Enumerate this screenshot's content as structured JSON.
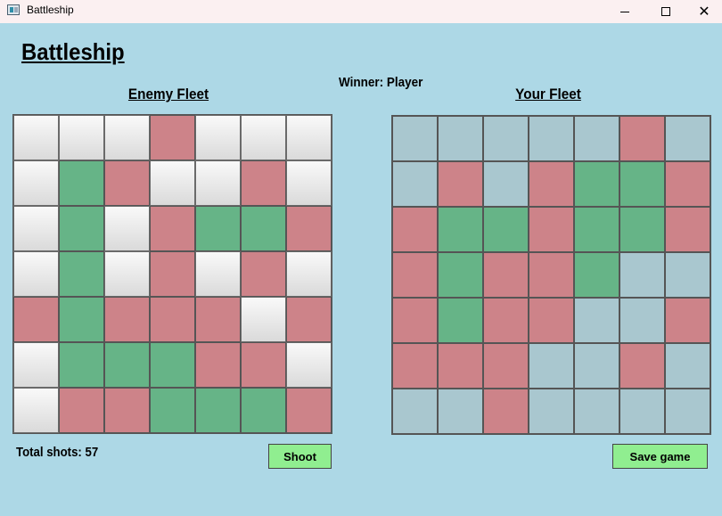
{
  "window": {
    "title": "Battleship",
    "minimize_icon": "minimize-icon",
    "maximize_icon": "maximize-icon",
    "close_glyph": "✕"
  },
  "heading": "Battleship",
  "winner_text": "Winner: Player",
  "enemy": {
    "label": "Enemy Fleet",
    "grid": [
      [
        "unknown",
        "unknown",
        "unknown",
        "miss",
        "unknown",
        "unknown",
        "unknown"
      ],
      [
        "unknown",
        "hit",
        "miss",
        "unknown",
        "unknown",
        "miss",
        "unknown"
      ],
      [
        "unknown",
        "hit",
        "unknown",
        "miss",
        "hit",
        "hit",
        "miss"
      ],
      [
        "unknown",
        "hit",
        "unknown",
        "miss",
        "unknown",
        "miss",
        "unknown"
      ],
      [
        "miss",
        "hit",
        "miss",
        "miss",
        "miss",
        "unknown",
        "miss"
      ],
      [
        "unknown",
        "hit",
        "hit",
        "hit",
        "miss",
        "miss",
        "unknown"
      ],
      [
        "unknown",
        "miss",
        "miss",
        "hit",
        "hit",
        "hit",
        "miss"
      ]
    ]
  },
  "player": {
    "label": "Your Fleet",
    "grid": [
      [
        "water",
        "water",
        "water",
        "water",
        "water",
        "miss",
        "water"
      ],
      [
        "water",
        "miss",
        "water",
        "miss",
        "hit",
        "hit",
        "miss"
      ],
      [
        "miss",
        "hit",
        "hit",
        "miss",
        "hit",
        "hit",
        "miss"
      ],
      [
        "miss",
        "hit",
        "miss",
        "miss",
        "hit",
        "water",
        "water"
      ],
      [
        "miss",
        "hit",
        "miss",
        "miss",
        "water",
        "water",
        "miss"
      ],
      [
        "miss",
        "miss",
        "miss",
        "water",
        "water",
        "miss",
        "water"
      ],
      [
        "water",
        "water",
        "miss",
        "water",
        "water",
        "water",
        "water"
      ]
    ]
  },
  "stats": {
    "total_shots": "Total shots: 57"
  },
  "buttons": {
    "shoot": "Shoot",
    "save": "Save game"
  },
  "colors": {
    "background": "#add8e6",
    "hit": "#66b487",
    "miss": "#cd8389",
    "water": "#a9c7cf",
    "button": "#90ee90"
  }
}
